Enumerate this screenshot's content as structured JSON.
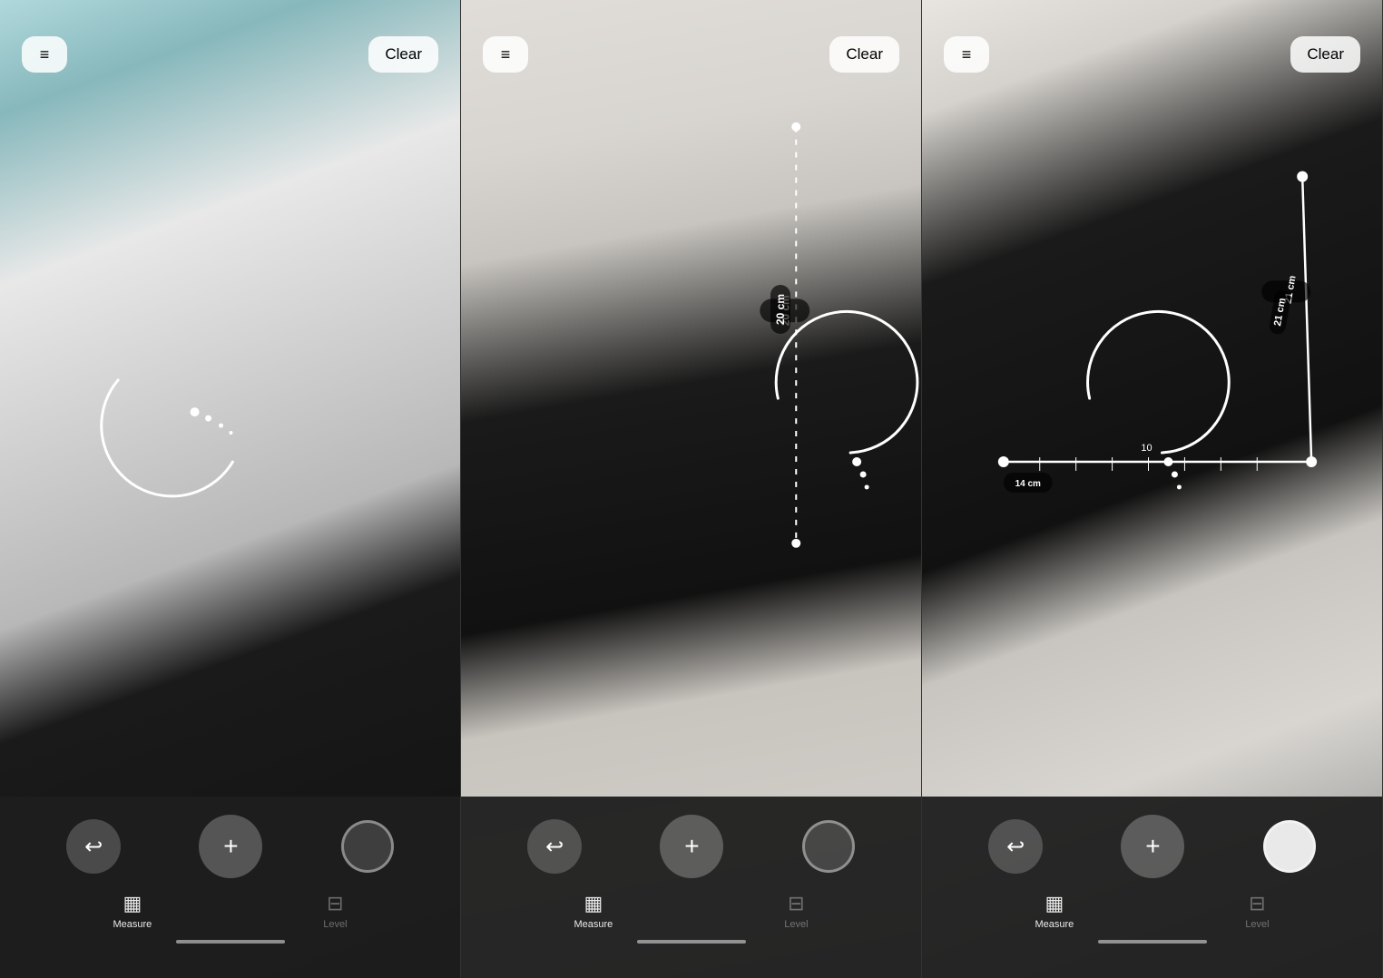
{
  "panels": [
    {
      "id": "panel-1",
      "clear_label": "Clear",
      "menu_icon": "≡",
      "measurement": null,
      "controls": {
        "undo_icon": "↩",
        "add_icon": "+",
        "capture": true
      },
      "tabs": [
        {
          "label": "Measure",
          "icon": "▦",
          "active": true
        },
        {
          "label": "Level",
          "icon": "⊟",
          "active": false
        }
      ]
    },
    {
      "id": "panel-2",
      "clear_label": "Clear",
      "menu_icon": "≡",
      "measurement": "20 cm",
      "controls": {
        "undo_icon": "↩",
        "add_icon": "+",
        "capture": true
      },
      "tabs": [
        {
          "label": "Measure",
          "icon": "▦",
          "active": true
        },
        {
          "label": "Level",
          "icon": "⊟",
          "active": false
        }
      ]
    },
    {
      "id": "panel-3",
      "clear_label": "Clear",
      "menu_icon": "≡",
      "measurement_1": "21 cm",
      "measurement_2": "14 cm",
      "controls": {
        "undo_icon": "↩",
        "add_icon": "+",
        "capture": true
      },
      "tabs": [
        {
          "label": "Measure",
          "icon": "▦",
          "active": true
        },
        {
          "label": "Level",
          "icon": "⊟",
          "active": false
        }
      ]
    }
  ]
}
